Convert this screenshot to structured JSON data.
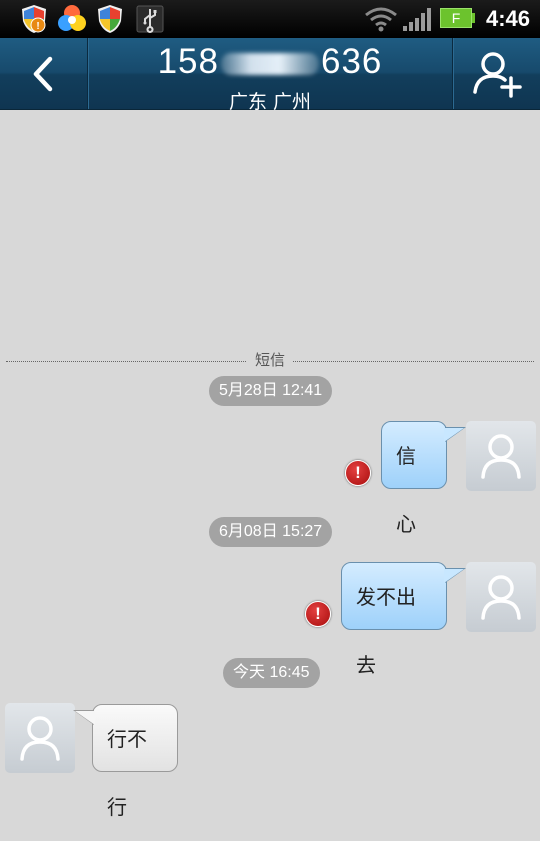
{
  "status_bar": {
    "time": "4:46",
    "battery_label": "F",
    "icons": [
      "shield-alert-icon",
      "color-app-icon",
      "shield-icon",
      "usb-icon",
      "wifi-icon",
      "signal-icon",
      "battery-icon"
    ]
  },
  "header": {
    "number_prefix": "158",
    "number_suffix": "636",
    "location": "广东 广州",
    "back_icon": "back-chevron-icon",
    "add_contact_icon": "add-contact-icon"
  },
  "divider_label": "短信",
  "messages": [
    {
      "timestamp": "5月28日 12:41",
      "direction": "out",
      "text": "信心",
      "failed": true
    },
    {
      "timestamp": "6月08日 15:27",
      "direction": "out",
      "text": "发不出去",
      "failed": true
    },
    {
      "timestamp": "今天 16:45",
      "direction": "in",
      "text": "行不行",
      "failed": false
    }
  ],
  "colors": {
    "header_bg": "#174a6c",
    "outgoing_bubble": "#a8d6fb",
    "error_icon": "#c01515",
    "timestamp_pill": "#a3a3a3"
  }
}
